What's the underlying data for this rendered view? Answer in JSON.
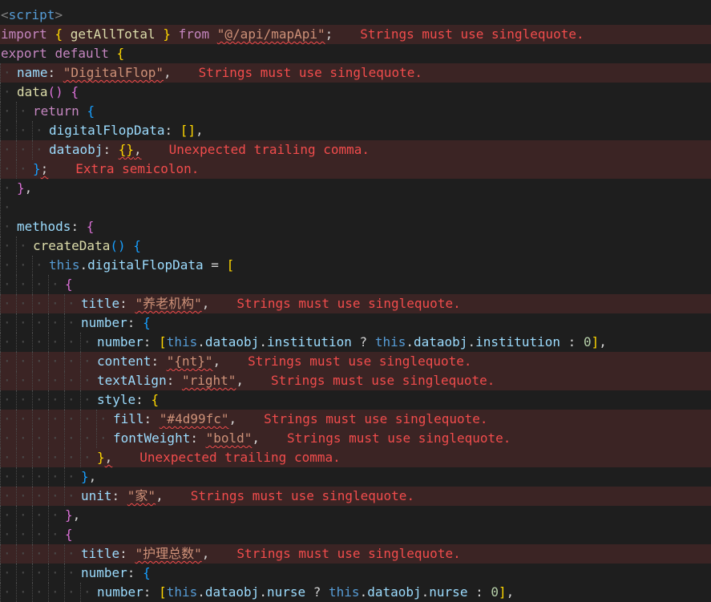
{
  "editor": {
    "language": "javascript",
    "theme_background": "#1e1e1e",
    "error_color": "#f14c4c",
    "lines": [
      {
        "indent": 0,
        "tokens": [
          [
            "tag",
            "<"
          ],
          [
            "kw2",
            "script"
          ],
          [
            "tag",
            ">"
          ]
        ]
      },
      {
        "indent": 0,
        "err": true,
        "tokens": [
          [
            "kw",
            "import"
          ],
          [
            "op",
            " "
          ],
          [
            "p1",
            "{"
          ],
          [
            "op",
            " "
          ],
          [
            "fn",
            "getAllTotal"
          ],
          [
            "op",
            " "
          ],
          [
            "p1",
            "}"
          ],
          [
            "op",
            " "
          ],
          [
            "kw",
            "from"
          ],
          [
            "op",
            " "
          ],
          [
            "str",
            "\"@/api/mapApi\"",
            1
          ],
          [
            "op",
            ";"
          ]
        ],
        "msg": "Strings must use singlequote."
      },
      {
        "indent": 0,
        "tokens": [
          [
            "kw",
            "export"
          ],
          [
            "op",
            " "
          ],
          [
            "kw",
            "default"
          ],
          [
            "op",
            " "
          ],
          [
            "p1",
            "{"
          ]
        ]
      },
      {
        "indent": 1,
        "err": true,
        "tokens": [
          [
            "var",
            "name"
          ],
          [
            "op",
            ": "
          ],
          [
            "str",
            "\"DigitalFlop\"",
            1
          ],
          [
            "op",
            ","
          ]
        ],
        "msg": "Strings must use singlequote."
      },
      {
        "indent": 1,
        "tokens": [
          [
            "fn",
            "data"
          ],
          [
            "p2",
            "()"
          ],
          [
            "op",
            " "
          ],
          [
            "p2",
            "{"
          ]
        ]
      },
      {
        "indent": 2,
        "tokens": [
          [
            "kw",
            "return"
          ],
          [
            "op",
            " "
          ],
          [
            "p3",
            "{"
          ]
        ]
      },
      {
        "indent": 3,
        "tokens": [
          [
            "var",
            "digitalFlopData"
          ],
          [
            "op",
            ": "
          ],
          [
            "p1",
            "[]"
          ],
          [
            "op",
            ","
          ]
        ]
      },
      {
        "indent": 3,
        "err": true,
        "tokens": [
          [
            "var",
            "dataobj"
          ],
          [
            "op",
            ": "
          ],
          [
            "p1",
            "{}",
            1
          ],
          [
            "op",
            ",",
            1
          ]
        ],
        "msg": "Unexpected trailing comma."
      },
      {
        "indent": 2,
        "err": true,
        "tokens": [
          [
            "p3",
            "}"
          ],
          [
            "op",
            ";",
            1
          ]
        ],
        "msg": "Extra semicolon."
      },
      {
        "indent": 1,
        "tokens": [
          [
            "p2",
            "}"
          ],
          [
            "op",
            ","
          ]
        ]
      },
      {
        "indent": 1,
        "tokens": []
      },
      {
        "indent": 1,
        "tokens": [
          [
            "var",
            "methods"
          ],
          [
            "op",
            ": "
          ],
          [
            "p2",
            "{"
          ]
        ]
      },
      {
        "indent": 2,
        "tokens": [
          [
            "fn",
            "createData"
          ],
          [
            "p3",
            "()"
          ],
          [
            "op",
            " "
          ],
          [
            "p3",
            "{"
          ]
        ]
      },
      {
        "indent": 3,
        "tokens": [
          [
            "kw2",
            "this"
          ],
          [
            "op",
            "."
          ],
          [
            "var",
            "digitalFlopData"
          ],
          [
            "op",
            " = "
          ],
          [
            "p1",
            "["
          ]
        ]
      },
      {
        "indent": 4,
        "tokens": [
          [
            "p2",
            "{"
          ]
        ]
      },
      {
        "indent": 5,
        "err": true,
        "tokens": [
          [
            "var",
            "title"
          ],
          [
            "op",
            ": "
          ],
          [
            "str",
            "\"养老机构\"",
            1
          ],
          [
            "op",
            ","
          ]
        ],
        "msg": "Strings must use singlequote."
      },
      {
        "indent": 5,
        "tokens": [
          [
            "var",
            "number"
          ],
          [
            "op",
            ": "
          ],
          [
            "p3",
            "{"
          ]
        ]
      },
      {
        "indent": 6,
        "tokens": [
          [
            "var",
            "number"
          ],
          [
            "op",
            ": "
          ],
          [
            "p1",
            "["
          ],
          [
            "kw2",
            "this"
          ],
          [
            "op",
            "."
          ],
          [
            "var",
            "dataobj"
          ],
          [
            "op",
            "."
          ],
          [
            "var",
            "institution"
          ],
          [
            "op",
            " ? "
          ],
          [
            "kw2",
            "this"
          ],
          [
            "op",
            "."
          ],
          [
            "var",
            "dataobj"
          ],
          [
            "op",
            "."
          ],
          [
            "var",
            "institution"
          ],
          [
            "op",
            " : "
          ],
          [
            "num",
            "0"
          ],
          [
            "p1",
            "]"
          ],
          [
            "op",
            ","
          ]
        ]
      },
      {
        "indent": 6,
        "err": true,
        "tokens": [
          [
            "var",
            "content"
          ],
          [
            "op",
            ": "
          ],
          [
            "str",
            "\"{nt}\"",
            1
          ],
          [
            "op",
            ","
          ]
        ],
        "msg": "Strings must use singlequote."
      },
      {
        "indent": 6,
        "err": true,
        "tokens": [
          [
            "var",
            "textAlign"
          ],
          [
            "op",
            ": "
          ],
          [
            "str",
            "\"right\"",
            1
          ],
          [
            "op",
            ","
          ]
        ],
        "msg": "Strings must use singlequote."
      },
      {
        "indent": 6,
        "tokens": [
          [
            "var",
            "style"
          ],
          [
            "op",
            ": "
          ],
          [
            "p1",
            "{"
          ]
        ]
      },
      {
        "indent": 7,
        "err": true,
        "tokens": [
          [
            "var",
            "fill"
          ],
          [
            "op",
            ": "
          ],
          [
            "str",
            "\"#4d99fc\"",
            1
          ],
          [
            "op",
            ","
          ]
        ],
        "msg": "Strings must use singlequote."
      },
      {
        "indent": 7,
        "err": true,
        "tokens": [
          [
            "var",
            "fontWeight"
          ],
          [
            "op",
            ": "
          ],
          [
            "str",
            "\"bold\"",
            1
          ],
          [
            "op",
            ","
          ]
        ],
        "msg": "Strings must use singlequote."
      },
      {
        "indent": 6,
        "err": true,
        "tokens": [
          [
            "p1",
            "}"
          ],
          [
            "op",
            ",",
            1
          ]
        ],
        "msg": "Unexpected trailing comma."
      },
      {
        "indent": 5,
        "tokens": [
          [
            "p3",
            "}"
          ],
          [
            "op",
            ","
          ]
        ]
      },
      {
        "indent": 5,
        "err": true,
        "tokens": [
          [
            "var",
            "unit"
          ],
          [
            "op",
            ": "
          ],
          [
            "str",
            "\"家\"",
            1
          ],
          [
            "op",
            ","
          ]
        ],
        "msg": "Strings must use singlequote."
      },
      {
        "indent": 4,
        "tokens": [
          [
            "p2",
            "}"
          ],
          [
            "op",
            ","
          ]
        ]
      },
      {
        "indent": 4,
        "tokens": [
          [
            "p2",
            "{"
          ]
        ]
      },
      {
        "indent": 5,
        "err": true,
        "tokens": [
          [
            "var",
            "title"
          ],
          [
            "op",
            ": "
          ],
          [
            "str",
            "\"护理总数\"",
            1
          ],
          [
            "op",
            ","
          ]
        ],
        "msg": "Strings must use singlequote."
      },
      {
        "indent": 5,
        "tokens": [
          [
            "var",
            "number"
          ],
          [
            "op",
            ": "
          ],
          [
            "p3",
            "{"
          ]
        ]
      },
      {
        "indent": 6,
        "tokens": [
          [
            "var",
            "number"
          ],
          [
            "op",
            ": "
          ],
          [
            "p1",
            "["
          ],
          [
            "kw2",
            "this"
          ],
          [
            "op",
            "."
          ],
          [
            "var",
            "dataobj"
          ],
          [
            "op",
            "."
          ],
          [
            "var",
            "nurse"
          ],
          [
            "op",
            " ? "
          ],
          [
            "kw2",
            "this"
          ],
          [
            "op",
            "."
          ],
          [
            "var",
            "dataobj"
          ],
          [
            "op",
            "."
          ],
          [
            "var",
            "nurse"
          ],
          [
            "op",
            " : "
          ],
          [
            "num",
            "0"
          ],
          [
            "p1",
            "]"
          ],
          [
            "op",
            ","
          ]
        ]
      }
    ]
  }
}
